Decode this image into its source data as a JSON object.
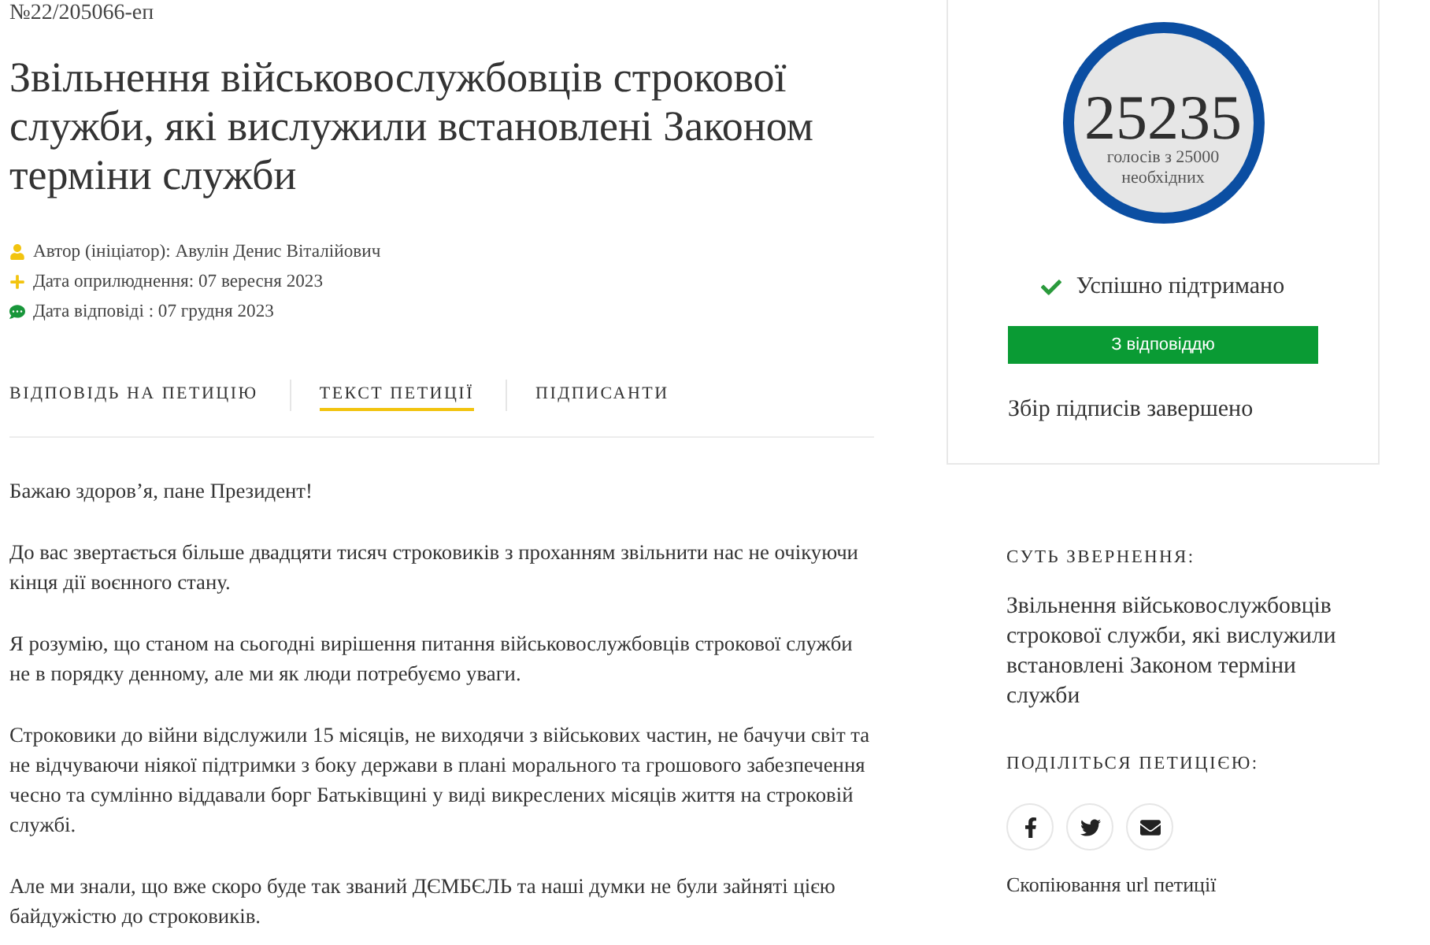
{
  "petition_number": "№22/205066-еп",
  "title": "Звільнення військовослужбовців строкової служби, які вислужили встановлені Законом терміни служби",
  "meta": [
    {
      "kind": "author",
      "text": "Автор (ініціатор): Авулін Денис Віталійович"
    },
    {
      "kind": "published",
      "text": "Дата оприлюднення: 07 вересня 2023"
    },
    {
      "kind": "answered",
      "text": "Дата відповіді : 07 грудня 2023"
    }
  ],
  "tabs": [
    {
      "label": "ВІДПОВІДЬ НА ПЕТИЦІЮ",
      "selected": false
    },
    {
      "label": "ТЕКСТ ПЕТИЦІЇ",
      "selected": true
    },
    {
      "label": "ПІДПИСАНТИ",
      "selected": false
    }
  ],
  "body": [
    "Бажаю здоров’я, пане Президент!",
    "До вас звертається більше двадцяти тисяч строковиків з проханням звільнити нас не очікуючи кінця дії воєнного стану.",
    "Я розумію, що станом на сьогодні вирішення питання військовослужбовців строкової служби не в порядку денному, але ми як люди потребуємо уваги.",
    "Строковики до війни відслужили 15 місяців, не виходячи з військових частин, не бачучи світ та не відчуваючи ніякої підтримки з боку держави в плані морального та грошового забезпечення чесно та сумлінно віддавали борг Батьківщині у виді викреслених місяців життя на строковій службі.",
    "Але ми знали, що вже скоро буде так званий ДЄМБЄЛЬ та наші думки не були зайняті цією байдужістю до строковиків."
  ],
  "votes": {
    "count": "25235",
    "caption": "голосів з 25000 необхідних",
    "level": 1
  },
  "status": "Успішно підтримано",
  "answer_status": "З відповіддю",
  "collection_status": "Збір підписів завершено",
  "summary": {
    "heading": "СУТЬ ЗВЕРНЕННЯ:",
    "text": "Звільнення військовослужбовців строкової служби, які вислужили встановлені Законом терміни служби"
  },
  "share": {
    "heading": "ПОДІЛІТЬСЯ ПЕТИЦІЄЮ:",
    "buttons": [
      {
        "kind": "facebook"
      },
      {
        "kind": "twitter"
      },
      {
        "kind": "email"
      }
    ],
    "copy_link": "Скопіювання url петиції"
  }
}
